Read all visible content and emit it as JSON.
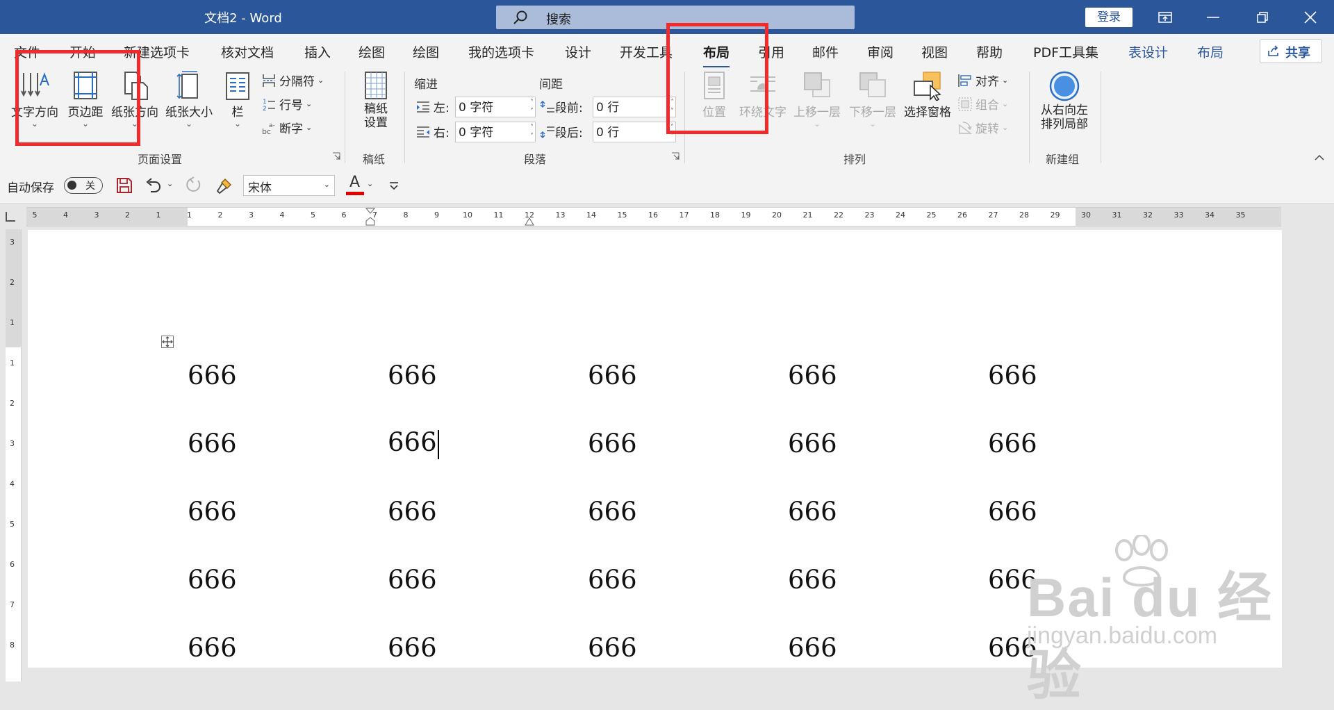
{
  "title_bar": {
    "doc_title": "文档2  -  Word",
    "search_placeholder": "搜索",
    "login_label": "登录",
    "window_controls": [
      "ribbon-display-icon",
      "minimize-icon",
      "restore-icon",
      "close-icon"
    ]
  },
  "tabs": [
    {
      "label": "文件"
    },
    {
      "label": "开始"
    },
    {
      "label": "新建选项卡"
    },
    {
      "label": "核对文档"
    },
    {
      "label": "插入"
    },
    {
      "label": "绘图"
    },
    {
      "label": "绘图"
    },
    {
      "label": "我的选项卡"
    },
    {
      "label": "设计"
    },
    {
      "label": "开发工具"
    },
    {
      "label": "布局",
      "active": true
    },
    {
      "label": "引用"
    },
    {
      "label": "邮件"
    },
    {
      "label": "审阅"
    },
    {
      "label": "视图"
    },
    {
      "label": "帮助"
    },
    {
      "label": "PDF工具集"
    },
    {
      "label": "表设计",
      "contextual": true
    },
    {
      "label": "布局",
      "contextual": true
    }
  ],
  "share_label": "共享",
  "ribbon": {
    "page_setup": {
      "label": "页面设置",
      "text_direction": "文字方向",
      "margins": "页边距",
      "orientation": "纸张方向",
      "size": "纸张大小",
      "columns": "栏",
      "breaks": "分隔符",
      "line_numbers": "行号",
      "hyphenation": "断字"
    },
    "manuscript": {
      "label": "稿纸",
      "settings_line1": "稿纸",
      "settings_line2": "设置"
    },
    "paragraph": {
      "label": "段落",
      "indent_title": "缩进",
      "spacing_title": "间距",
      "left_label": "左:",
      "right_label": "右:",
      "before_label": "段前:",
      "after_label": "段后:",
      "left_value": "0 字符",
      "right_value": "0 字符",
      "before_value": "0 行",
      "after_value": "0 行"
    },
    "arrange": {
      "label": "排列",
      "position": "位置",
      "wrap_text": "环绕文字",
      "bring_forward": "上移一层",
      "send_backward": "下移一层",
      "selection_pane": "选择窗格",
      "align": "对齐",
      "group": "组合",
      "rotate": "旋转"
    },
    "new_group": {
      "label": "新建组",
      "rtl_line1": "从右向左",
      "rtl_line2": "排列局部"
    }
  },
  "qat": {
    "autosave_label": "自动保存",
    "toggle_state": "关",
    "font_name": "宋体"
  },
  "hruler_labels": [
    "5",
    "4",
    "3",
    "2",
    "1",
    "1",
    "2",
    "3",
    "4",
    "5",
    "6",
    "7",
    "8",
    "9",
    "10",
    "11",
    "12",
    "13",
    "14",
    "15",
    "16",
    "17",
    "18",
    "19",
    "20",
    "21",
    "22",
    "23",
    "24",
    "25",
    "26",
    "27",
    "28",
    "29",
    "30",
    "31",
    "32",
    "33",
    "34",
    "35"
  ],
  "vruler_labels": [
    "3",
    "2",
    "1",
    "1",
    "2",
    "3",
    "4",
    "5",
    "6",
    "7",
    "8"
  ],
  "table": [
    [
      "666",
      "666",
      "666",
      "666",
      "666"
    ],
    [
      "666",
      "666",
      "666",
      "666",
      "666"
    ],
    [
      "666",
      "666",
      "666",
      "666",
      "666"
    ],
    [
      "666",
      "666",
      "666",
      "666",
      "666"
    ],
    [
      "666",
      "666",
      "666",
      "666",
      "666"
    ]
  ],
  "colors": {
    "title_bar": "#2b579a",
    "highlight_box": "#ef2b2b",
    "font_color_bar": "#e00000"
  },
  "watermark": {
    "main": "Bai du 经验",
    "url": "jingyan.baidu.com"
  }
}
